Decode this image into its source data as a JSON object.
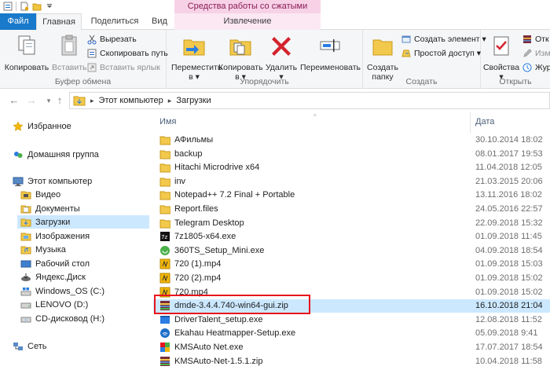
{
  "window": {
    "context_title": "Средства работы со сжатыми папками"
  },
  "tabs": {
    "file": "Файл",
    "home": "Главная",
    "share": "Поделиться",
    "view": "Вид",
    "manage": "Извлечение"
  },
  "ribbon": {
    "clipboard": {
      "copy": "Копировать",
      "paste": "Вставить",
      "cut": "Вырезать",
      "copy_path": "Скопировать путь",
      "paste_shortcut": "Вставить ярлык",
      "label": "Буфер обмена"
    },
    "organize": {
      "move_to_line1": "Переместить",
      "move_to_line2": "в ▾",
      "copy_to_line1": "Копировать",
      "copy_to_line2": "в ▾",
      "delete_line1": "Удалить",
      "delete_line2": "▾",
      "rename": "Переименовать",
      "label": "Упорядочить"
    },
    "new": {
      "new_folder_line1": "Создать",
      "new_folder_line2": "папку",
      "new_item": "Создать элемент ▾",
      "easy_access": "Простой доступ ▾",
      "label": "Создать"
    },
    "open": {
      "properties_line1": "Свойства",
      "properties_line2": "▾",
      "open_item": "Отк",
      "edit_item": "Изм",
      "history_item": "Жур",
      "label": "Открыть"
    }
  },
  "address": {
    "back": "←",
    "forward": "→",
    "up": "↑",
    "crumbs": [
      "Этот компьютер",
      "Загрузки"
    ]
  },
  "nav": {
    "favorites": "Избранное",
    "homegroup": "Домашняя группа",
    "this_pc": "Этот компьютер",
    "items": [
      "Видео",
      "Документы",
      "Загрузки",
      "Изображения",
      "Музыка",
      "Рабочий стол",
      "Яндекс.Диск",
      "Windows_OS (C:)",
      "LENOVO (D:)",
      "CD-дисковод (H:)"
    ],
    "network": "Сеть"
  },
  "columns": {
    "name": "Имя",
    "date": "Дата"
  },
  "files": [
    {
      "name": "АФильмы",
      "date": "30.10.2014 18:02",
      "type": "folder"
    },
    {
      "name": "backup",
      "date": "08.01.2017 19:53",
      "type": "folder"
    },
    {
      "name": "Hitachi Microdrive x64",
      "date": "11.04.2018 12:05",
      "type": "folder"
    },
    {
      "name": "inv",
      "date": "21.03.2015 20:06",
      "type": "folder"
    },
    {
      "name": "Notepad++ 7.2 Final + Portable",
      "date": "13.11.2016 18:02",
      "type": "folder"
    },
    {
      "name": "Report.files",
      "date": "24.05.2016 22:57",
      "type": "folder"
    },
    {
      "name": "Telegram Desktop",
      "date": "22.09.2018 15:32",
      "type": "folder"
    },
    {
      "name": "7z1805-x64.exe",
      "date": "01.09.2018 11:45",
      "type": "7z"
    },
    {
      "name": "360TS_Setup_Mini.exe",
      "date": "04.09.2018 18:54",
      "type": "360"
    },
    {
      "name": "720 (1).mp4",
      "date": "01.09.2018 15:03",
      "type": "media"
    },
    {
      "name": "720 (2).mp4",
      "date": "01.09.2018 15:02",
      "type": "media"
    },
    {
      "name": "720.mp4",
      "date": "01.09.2018 15:02",
      "type": "media"
    },
    {
      "name": "dmde-3.4.4.740-win64-gui.zip",
      "date": "16.10.2018 21:04",
      "type": "zip"
    },
    {
      "name": "DriverTalent_setup.exe",
      "date": "12.08.2018 11:52",
      "type": "exe"
    },
    {
      "name": "Ekahau Heatmapper-Setup.exe",
      "date": "05.09.2018 9:41",
      "type": "wifi"
    },
    {
      "name": "KMSAuto Net.exe",
      "date": "17.07.2017 18:54",
      "type": "kms"
    },
    {
      "name": "KMSAuto-Net-1.5.1.zip",
      "date": "10.04.2018 11:58",
      "type": "zip"
    }
  ],
  "colors": {
    "selection": "#cce8ff",
    "highlight_box": "#e8141e",
    "file_tab": "#1979ca",
    "context_tab": "#f7d2e6"
  }
}
